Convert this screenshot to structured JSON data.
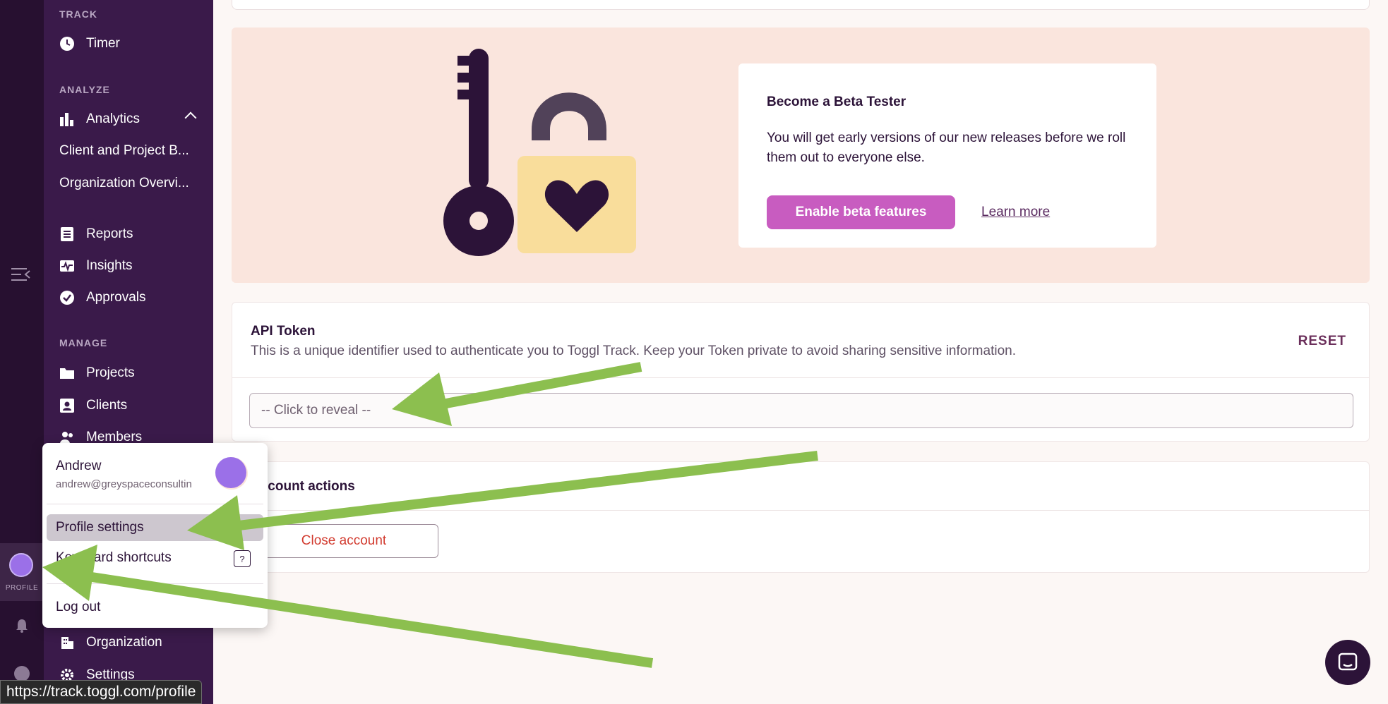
{
  "sidebar": {
    "sections": {
      "track": "TRACK",
      "analyze": "ANALYZE",
      "manage": "MANAGE"
    },
    "items": {
      "timer": "Timer",
      "analytics": "Analytics",
      "client_project": "Client and Project B...",
      "org_overview": "Organization Overvi...",
      "reports": "Reports",
      "insights": "Insights",
      "approvals": "Approvals",
      "projects": "Projects",
      "clients": "Clients",
      "members": "Members",
      "organization": "Organization",
      "settings": "Settings"
    }
  },
  "rail": {
    "profile_label": "PROFILE"
  },
  "beta": {
    "title": "Become a Beta Tester",
    "text": "You will get early versions of our new releases before we roll them out to everyone else.",
    "button": "Enable beta features",
    "link": "Learn more"
  },
  "api": {
    "title": "API Token",
    "description": "This is a unique identifier used to authenticate you to Toggl Track. Keep your Token private to avoid sharing sensitive information.",
    "reset": "RESET",
    "field_text": "-- Click to reveal --"
  },
  "account": {
    "title": "Account actions",
    "close_button": "Close account"
  },
  "profile_menu": {
    "name": "Andrew",
    "email": "andrew@greyspaceconsultin",
    "items": {
      "profile_settings": "Profile settings",
      "keyboard_shortcuts": "Keyboard shortcuts",
      "shortcut_key": "?",
      "logout": "Log out"
    }
  },
  "statusbar": {
    "url": "https://track.toggl.com/profile"
  },
  "colors": {
    "sidebar": "#3a1a4a",
    "rail": "#271030",
    "accent": "#c85cc0",
    "beta_bg": "#fae5dd",
    "arrow": "#8cbf4f",
    "danger": "#d23b2f"
  },
  "icons": {
    "timer": "clock-icon",
    "analytics": "bar-chart-icon",
    "reports": "document-icon",
    "insights": "activity-icon",
    "approvals": "check-circle-icon",
    "projects": "folder-icon",
    "clients": "contact-card-icon",
    "members": "people-icon",
    "organization": "building-icon",
    "settings": "gear-icon"
  }
}
